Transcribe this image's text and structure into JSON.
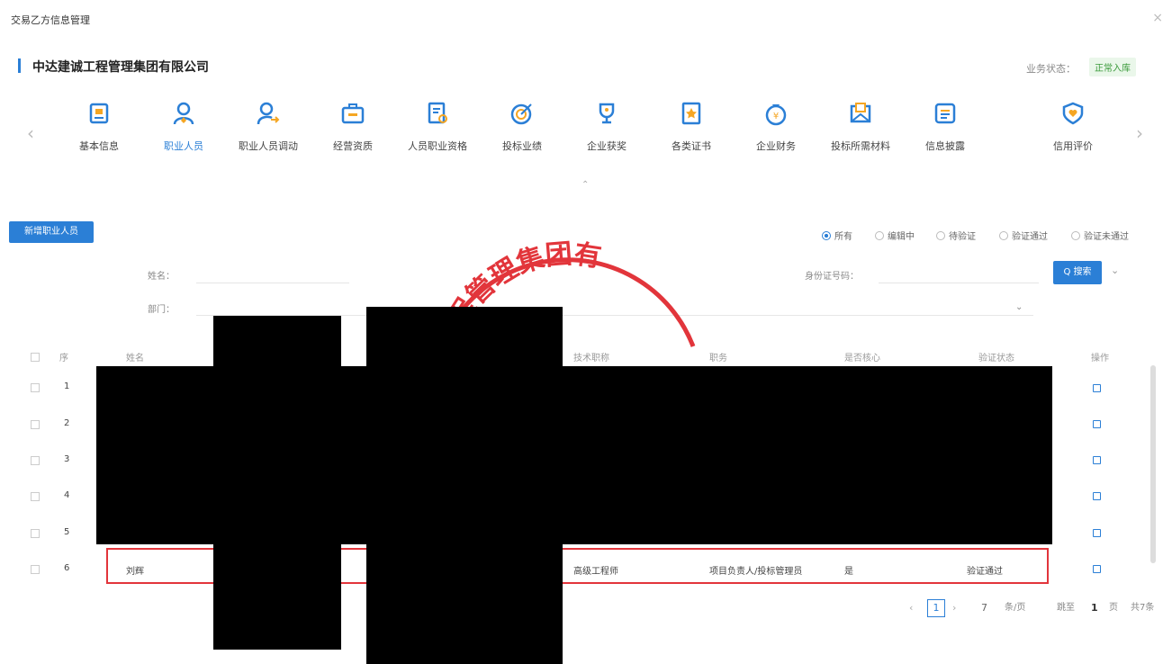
{
  "dialog": {
    "title": "交易乙方信息管理",
    "close_glyph": "×"
  },
  "company": {
    "name": "中达建诚工程管理集团有限公司",
    "status_label": "业务状态：",
    "status_value": "正常入库"
  },
  "nav": {
    "items": [
      {
        "label": "基本信息",
        "icon": "id-card-icon"
      },
      {
        "label": "职业人员",
        "icon": "user-icon",
        "active": true
      },
      {
        "label": "职业人员调动",
        "icon": "user-transfer-icon"
      },
      {
        "label": "经营资质",
        "icon": "briefcase-icon"
      },
      {
        "label": "人员职业资格",
        "icon": "certificate-doc-icon"
      },
      {
        "label": "投标业绩",
        "icon": "target-icon"
      },
      {
        "label": "企业获奖",
        "icon": "trophy-icon"
      },
      {
        "label": "各类证书",
        "icon": "star-certificate-icon"
      },
      {
        "label": "企业财务",
        "icon": "money-bag-icon"
      },
      {
        "label": "投标所需材料",
        "icon": "envelope-icon"
      },
      {
        "label": "信息披露",
        "icon": "notice-board-icon"
      },
      {
        "label": "信用评价",
        "icon": "shield-heart-icon"
      }
    ],
    "prev_glyph": "‹",
    "next_glyph": "›",
    "collapse_glyph": "⌃"
  },
  "toolbar": {
    "add_button": "新增职业人员",
    "filters": [
      "所有",
      "编辑中",
      "待验证",
      "验证通过",
      "验证未通过"
    ],
    "selected_filter": "所有"
  },
  "search": {
    "name_label": "姓名：",
    "id_label": "身份证号码：",
    "dept_label": "部门：",
    "search_button": "Q 搜索",
    "more_glyph": "⌄",
    "dept_select_glyph": "⌄"
  },
  "table": {
    "headers": [
      "序",
      "姓名",
      "技术职称",
      "职务",
      "是否核心",
      "验证状态",
      "操作"
    ],
    "rows": [
      {
        "seq": "1"
      },
      {
        "seq": "2"
      },
      {
        "seq": "3"
      },
      {
        "seq": "4"
      },
      {
        "seq": "5"
      },
      {
        "seq": "6",
        "name": "刘辉",
        "title": "高级工程师",
        "position": "项目负责人/投标管理员",
        "core": "是",
        "status": "验证通过"
      }
    ]
  },
  "seal": {
    "text": "工程管理集团有",
    "color": "#e2353b"
  },
  "pager": {
    "prev": "‹",
    "current": "1",
    "next": "›",
    "page_size": "7",
    "per_page_label": "条/页",
    "goto_label": "跳至",
    "goto_value": "1",
    "page_unit": "页",
    "total": "共7条"
  },
  "colors": {
    "accent": "#2b7fd6",
    "highlight": "#e2353b",
    "success": "#3a9a3a"
  }
}
